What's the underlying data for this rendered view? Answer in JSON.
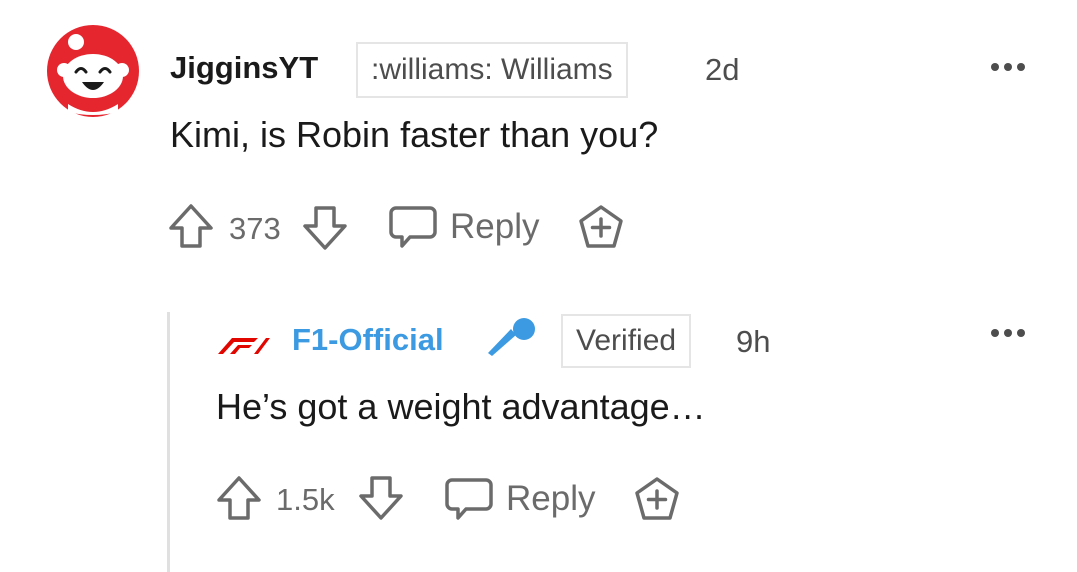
{
  "comments": [
    {
      "author": "JigginsYT",
      "flair": ":williams: Williams",
      "time": "2d",
      "body": "Kimi, is Robin faster than you?",
      "score": "373",
      "reply_label": "Reply"
    },
    {
      "author": "F1-Official",
      "flair": "Verified",
      "time": "9h",
      "body": "He’s got a weight advantage…",
      "score": "1.5k",
      "reply_label": "Reply"
    }
  ],
  "colors": {
    "avatar_red": "#e6262f",
    "official_blue": "#3b9ae1",
    "f1_red": "#e10600",
    "muted": "#6b6b6b"
  },
  "icons": {
    "avatar": "snoo-avatar",
    "upvote": "arrow-up-icon",
    "downvote": "arrow-down-icon",
    "reply": "speech-bubble-icon",
    "award": "plus-badge-icon",
    "more": "more-dots-icon",
    "official_badge": "microphone-icon",
    "f1_logo": "f1-logo"
  }
}
